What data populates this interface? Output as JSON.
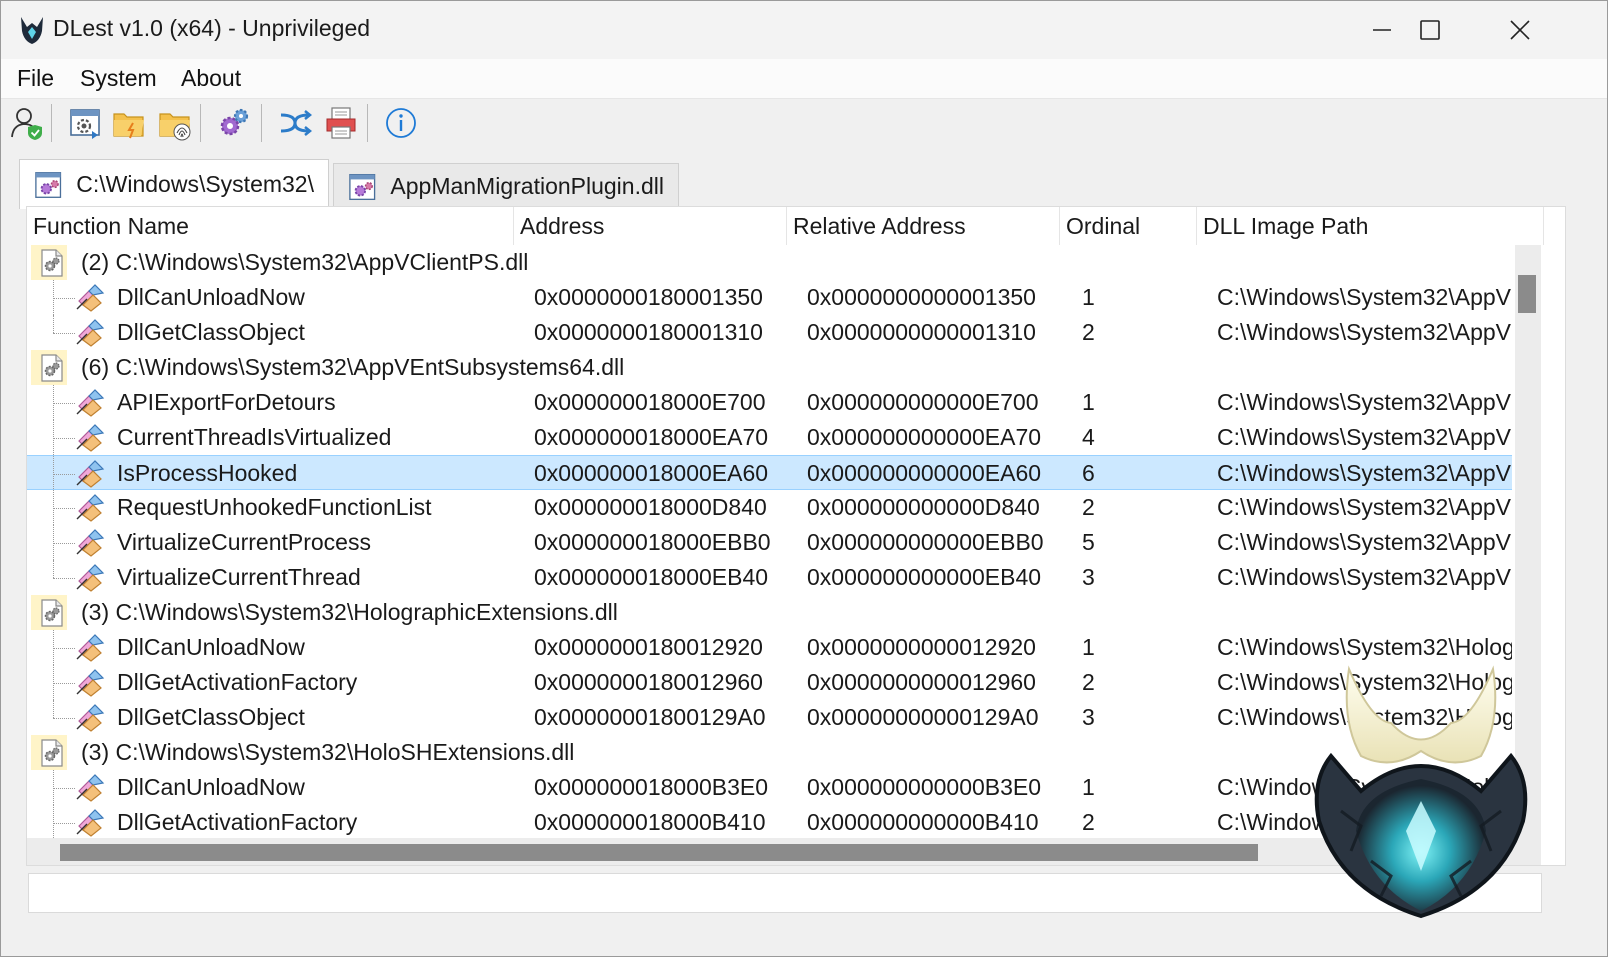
{
  "window": {
    "title": "DLest v1.0 (x64) - Unprivileged",
    "controls": {
      "minimize": "minimize-icon",
      "maximize": "maximize-icon",
      "close": "close-icon"
    }
  },
  "menu": {
    "items": [
      "File",
      "System",
      "About"
    ]
  },
  "toolbar": {
    "buttons": [
      {
        "name": "elevate-user-button",
        "icon": "user-shield-icon"
      },
      {
        "name": "load-process-button",
        "icon": "process-window-icon"
      },
      {
        "name": "open-folder-button",
        "icon": "folder-icon"
      },
      {
        "name": "open-signed-folder-button",
        "icon": "folder-fingerprint-icon"
      },
      {
        "name": "settings-button",
        "icon": "gears-icon"
      },
      {
        "name": "compare-button",
        "icon": "cross-arrows-icon"
      },
      {
        "name": "export-button",
        "icon": "printer-icon"
      },
      {
        "name": "about-button",
        "icon": "info-icon"
      }
    ]
  },
  "tabs": [
    {
      "label": "C:\\Windows\\System32\\",
      "active": true
    },
    {
      "label": "AppManMigrationPlugin.dll",
      "active": false
    }
  ],
  "columns": [
    "Function Name",
    "Address",
    "Relative Address",
    "Ordinal",
    "DLL Image Path"
  ],
  "rows": [
    {
      "type": "group",
      "label": "(2) C:\\Windows\\System32\\AppVClientPS.dll"
    },
    {
      "type": "function",
      "name": "DllCanUnloadNow",
      "address": "0x0000000180001350",
      "relative": "0x0000000000001350",
      "ordinal": "1",
      "path": "C:\\Windows\\System32\\AppV"
    },
    {
      "type": "function",
      "name": "DllGetClassObject",
      "address": "0x0000000180001310",
      "relative": "0x0000000000001310",
      "ordinal": "2",
      "path": "C:\\Windows\\System32\\AppV",
      "last": true
    },
    {
      "type": "group",
      "label": "(6) C:\\Windows\\System32\\AppVEntSubsystems64.dll"
    },
    {
      "type": "function",
      "name": "APIExportForDetours",
      "address": "0x000000018000E700",
      "relative": "0x000000000000E700",
      "ordinal": "1",
      "path": "C:\\Windows\\System32\\AppV"
    },
    {
      "type": "function",
      "name": "CurrentThreadIsVirtualized",
      "address": "0x000000018000EA70",
      "relative": "0x000000000000EA70",
      "ordinal": "4",
      "path": "C:\\Windows\\System32\\AppV"
    },
    {
      "type": "function",
      "name": "IsProcessHooked",
      "address": "0x000000018000EA60",
      "relative": "0x000000000000EA60",
      "ordinal": "6",
      "path": "C:\\Windows\\System32\\AppV",
      "selected": true
    },
    {
      "type": "function",
      "name": "RequestUnhookedFunctionList",
      "address": "0x000000018000D840",
      "relative": "0x000000000000D840",
      "ordinal": "2",
      "path": "C:\\Windows\\System32\\AppV"
    },
    {
      "type": "function",
      "name": "VirtualizeCurrentProcess",
      "address": "0x000000018000EBB0",
      "relative": "0x000000000000EBB0",
      "ordinal": "5",
      "path": "C:\\Windows\\System32\\AppV"
    },
    {
      "type": "function",
      "name": "VirtualizeCurrentThread",
      "address": "0x000000018000EB40",
      "relative": "0x000000000000EB40",
      "ordinal": "3",
      "path": "C:\\Windows\\System32\\AppV",
      "last": true
    },
    {
      "type": "group",
      "label": "(3) C:\\Windows\\System32\\HolographicExtensions.dll"
    },
    {
      "type": "function",
      "name": "DllCanUnloadNow",
      "address": "0x0000000180012920",
      "relative": "0x0000000000012920",
      "ordinal": "1",
      "path": "C:\\Windows\\System32\\Holog"
    },
    {
      "type": "function",
      "name": "DllGetActivationFactory",
      "address": "0x0000000180012960",
      "relative": "0x0000000000012960",
      "ordinal": "2",
      "path": "C:\\Windows\\System32\\Holog"
    },
    {
      "type": "function",
      "name": "DllGetClassObject",
      "address": "0x00000001800129A0",
      "relative": "0x00000000000129A0",
      "ordinal": "3",
      "path": "C:\\Windows\\System32\\Holog",
      "last": true
    },
    {
      "type": "group",
      "label": "(3) C:\\Windows\\System32\\HoloSHExtensions.dll"
    },
    {
      "type": "function",
      "name": "DllCanUnloadNow",
      "address": "0x000000018000B3E0",
      "relative": "0x000000000000B3E0",
      "ordinal": "1",
      "path": "C:\\Windows\\System32\\Holo"
    },
    {
      "type": "function",
      "name": "DllGetActivationFactory",
      "address": "0x000000018000B410",
      "relative": "0x000000000000B410",
      "ordinal": "2",
      "path": "C:\\Windows\\System32\\Holo"
    }
  ],
  "scroll": {
    "vertical_position": 0.05,
    "horizontal_position": 0.02
  },
  "status": {
    "text": ""
  },
  "colors": {
    "selection": "#cce8ff",
    "group_icon_bg": "#fff4c8",
    "accent": "#0067c0"
  },
  "logo": {
    "icon": "dragon-head-logo"
  }
}
